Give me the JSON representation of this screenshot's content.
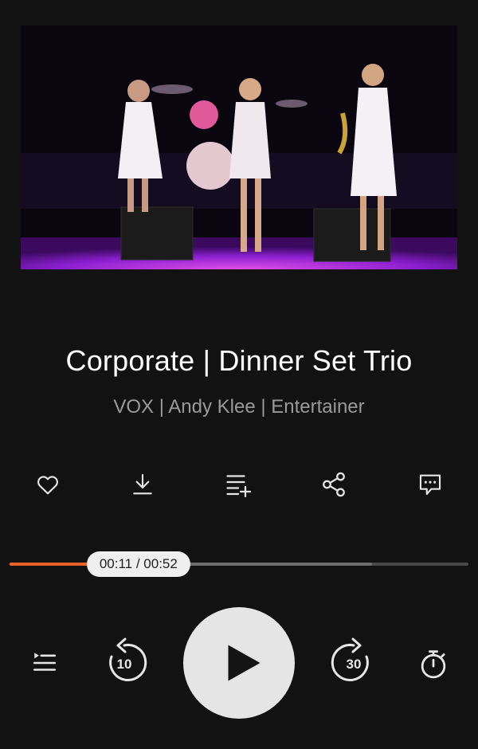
{
  "track": {
    "title": "Corporate | Dinner Set Trio",
    "artist": "VOX | Andy Klee | Entertainer"
  },
  "actions": [
    {
      "icon": "heart-icon"
    },
    {
      "icon": "download-icon"
    },
    {
      "icon": "add-to-playlist-icon"
    },
    {
      "icon": "share-icon"
    },
    {
      "icon": "comment-icon"
    }
  ],
  "progress": {
    "time_label": "00:11 / 00:52",
    "elapsed_seconds": 11,
    "duration_seconds": 52,
    "buffered_fraction": 0.79
  },
  "controls": {
    "skip_back_label": "10",
    "skip_forward_label": "30"
  },
  "colors": {
    "background": "#121212",
    "accent": "#e8622a",
    "stage_lighting": "#a02ad6"
  }
}
